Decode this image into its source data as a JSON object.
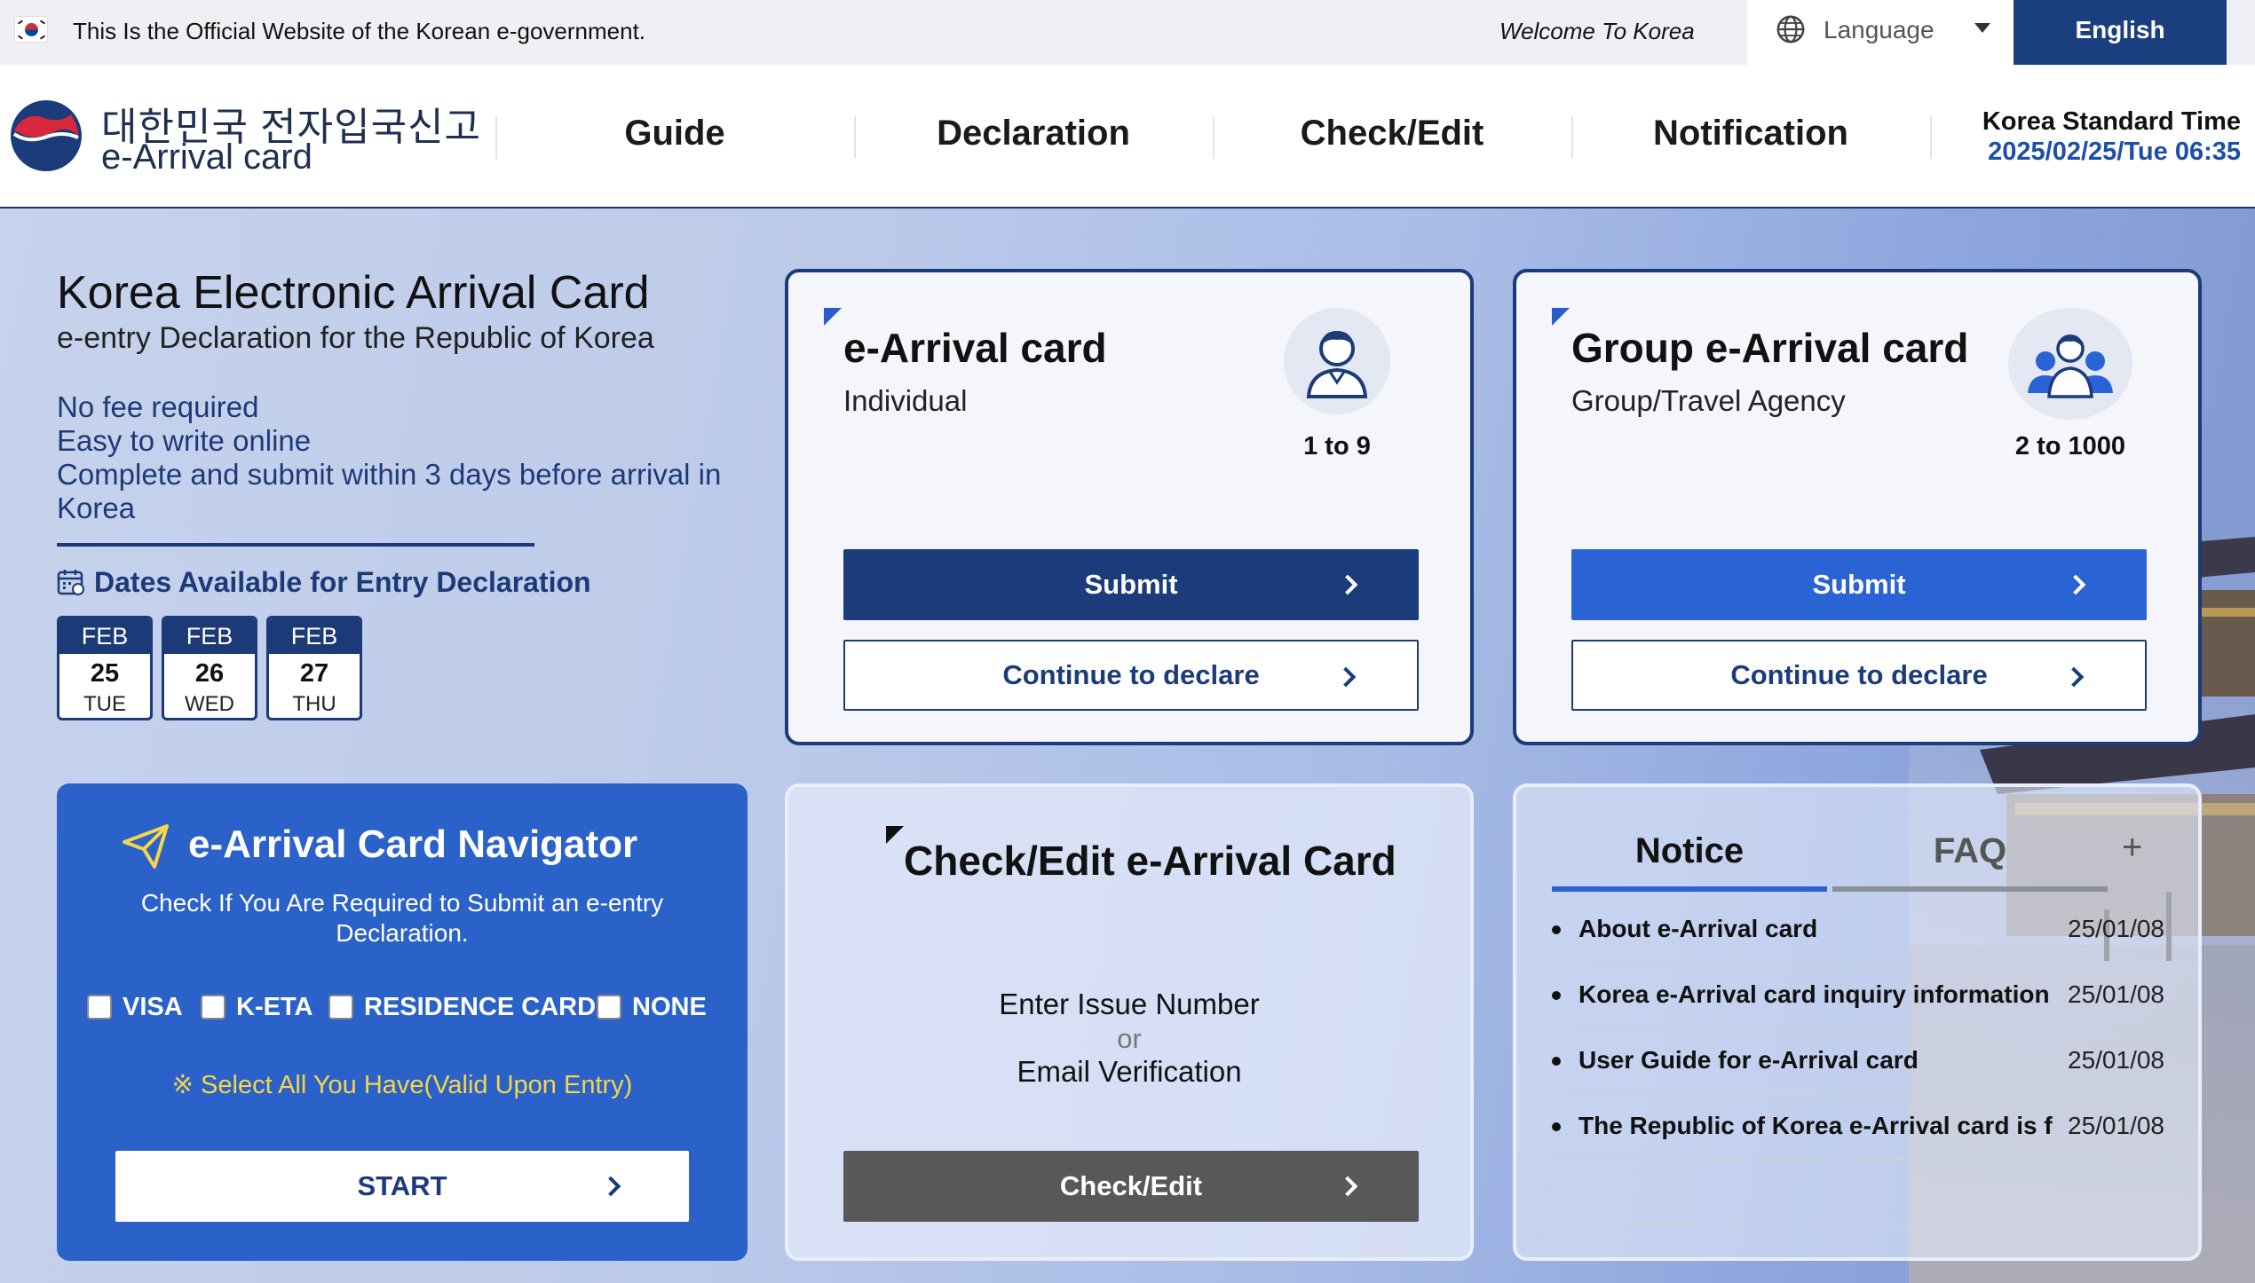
{
  "gov_bar": {
    "official_text": "This Is the Official Website of the Korean e-government.",
    "welcome": "Welcome To Korea",
    "language_label": "Language",
    "language_selected": "English"
  },
  "header": {
    "logo_ko": "대한민국 전자입국신고",
    "logo_en": "e-Arrival card",
    "nav": [
      "Guide",
      "Declaration",
      "Check/Edit",
      "Notification"
    ],
    "time_label": "Korea Standard Time",
    "time_value": "2025/02/25/Tue 06:35"
  },
  "intro": {
    "title": "Korea Electronic Arrival Card",
    "subtitle": "e-entry Declaration for the Republic of Korea",
    "features": [
      "No fee required",
      "Easy to write online",
      "Complete and submit within 3 days before arrival in",
      "Korea"
    ],
    "dates_title": "Dates Available for Entry Declaration",
    "dates": [
      {
        "month": "FEB",
        "day": "25",
        "weekday": "TUE"
      },
      {
        "month": "FEB",
        "day": "26",
        "weekday": "WED"
      },
      {
        "month": "FEB",
        "day": "27",
        "weekday": "THU"
      }
    ]
  },
  "individual_card": {
    "title": "e-Arrival card",
    "subtitle": "Individual",
    "count": "1 to 9",
    "submit": "Submit",
    "continue": "Continue to declare"
  },
  "group_card": {
    "title": "Group e-Arrival card",
    "subtitle": "Group/Travel Agency",
    "count": "2 to 1000",
    "submit": "Submit",
    "continue": "Continue to declare"
  },
  "navigator": {
    "title": "e-Arrival Card Navigator",
    "description": "Check If You Are Required to Submit an e-entry Declaration.",
    "options": [
      "VISA",
      "K-ETA",
      "RESIDENCE CARD",
      "NONE"
    ],
    "note": "※ Select All You Have(Valid Upon Entry)",
    "start": "START"
  },
  "check_edit": {
    "title": "Check/Edit e-Arrival Card",
    "line1": "Enter Issue Number",
    "or": "or",
    "line2": "Email Verification",
    "button": "Check/Edit"
  },
  "notice": {
    "tabs": [
      "Notice",
      "FAQ"
    ],
    "more": "+",
    "items": [
      {
        "title": "About e-Arrival card",
        "date": "25/01/08"
      },
      {
        "title": "Korea e-Arrival card inquiry information",
        "date": "25/01/08"
      },
      {
        "title": "User Guide for e-Arrival card",
        "date": "25/01/08"
      },
      {
        "title": "The Republic of Korea e-Arrival card is f",
        "date": "25/01/08"
      }
    ]
  },
  "colors": {
    "navy": "#1b3b7a",
    "blue": "#2a63d4",
    "navigator_bg": "#2a62c9",
    "note_yellow": "#f5d54a",
    "grey_button": "#585858"
  }
}
